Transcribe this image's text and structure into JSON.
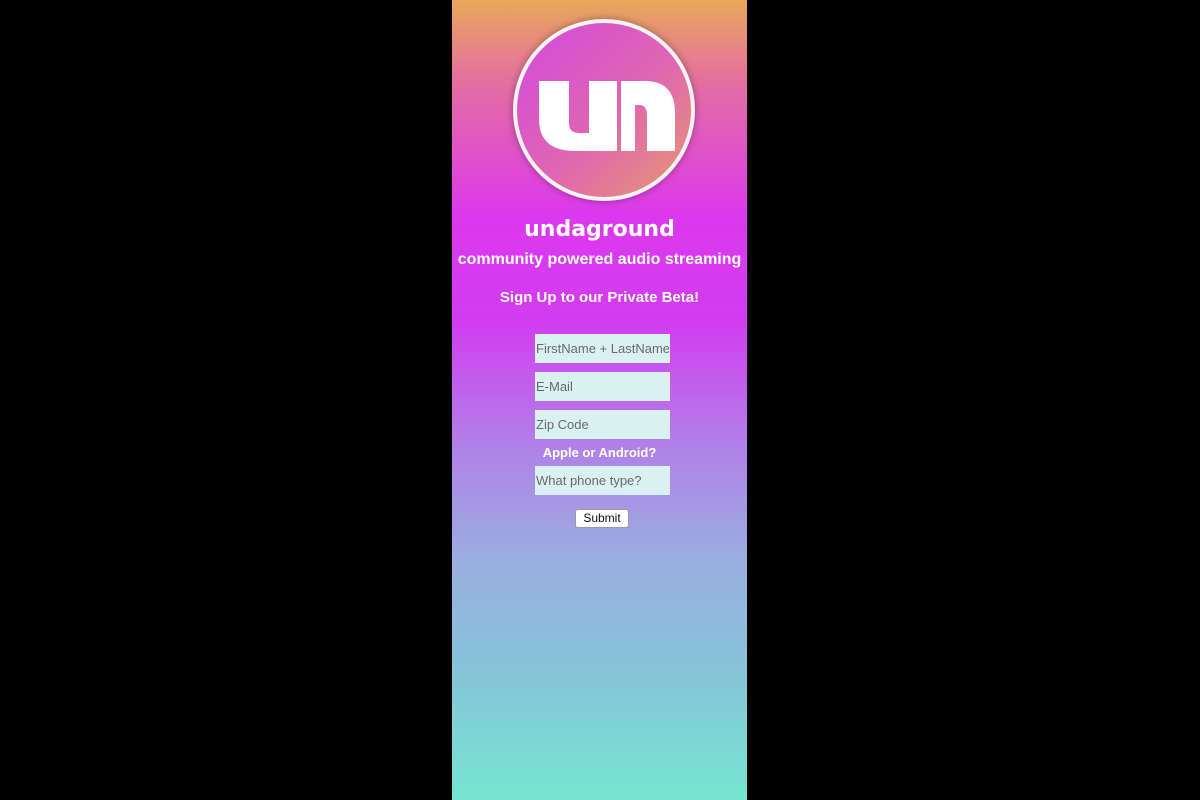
{
  "brand": {
    "name": "undaground",
    "tagline": "community powered audio streaming"
  },
  "signup": {
    "heading": "Sign Up to our Private Beta!",
    "fields": {
      "name_placeholder": "FirstName + LastName",
      "email_placeholder": "E-Mail",
      "zip_placeholder": "Zip Code",
      "phone_label": "Apple or Android?",
      "phone_placeholder": "What phone type?"
    },
    "submit_label": "Submit"
  },
  "colors": {
    "background_outer": "#000000",
    "gradient_top": "#e8a85a",
    "gradient_mid": "#dc38ee",
    "gradient_bottom": "#76e6d0",
    "input_fill": "#daf1f1"
  },
  "icons": {
    "logo": "undaground-un-logo"
  }
}
